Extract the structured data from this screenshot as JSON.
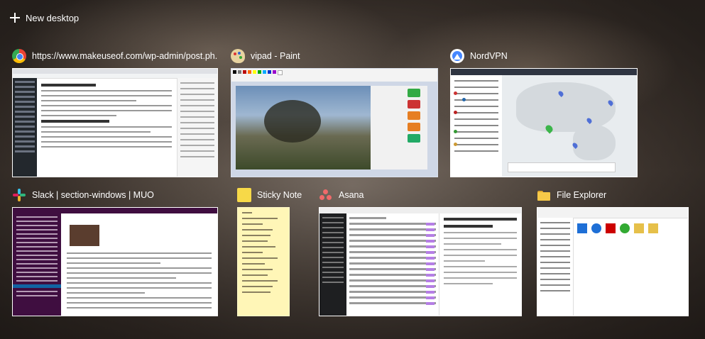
{
  "new_desktop": {
    "label": "New desktop"
  },
  "windows": [
    {
      "title": "https://www.makeuseof.com/wp-admin/post.ph...",
      "icon": "chrome-icon"
    },
    {
      "title": "vipad - Paint",
      "icon": "paint-icon"
    },
    {
      "title": "NordVPN",
      "icon": "nordvpn-icon"
    },
    {
      "title": "Slack | section-windows | MUO",
      "icon": "slack-icon"
    },
    {
      "title": "Sticky Note",
      "icon": "sticky-note-icon"
    },
    {
      "title": "Asana",
      "icon": "asana-icon"
    },
    {
      "title": "File Explorer",
      "icon": "folder-icon"
    }
  ],
  "colors": {
    "chrome": "#4285f4",
    "paint": "#e8d3a0",
    "nordvpn": "#4687ff",
    "slack": "#4a154b",
    "sticky": "#fff6b7",
    "asana": "#f06a6a",
    "explorer": "#f7c948"
  }
}
